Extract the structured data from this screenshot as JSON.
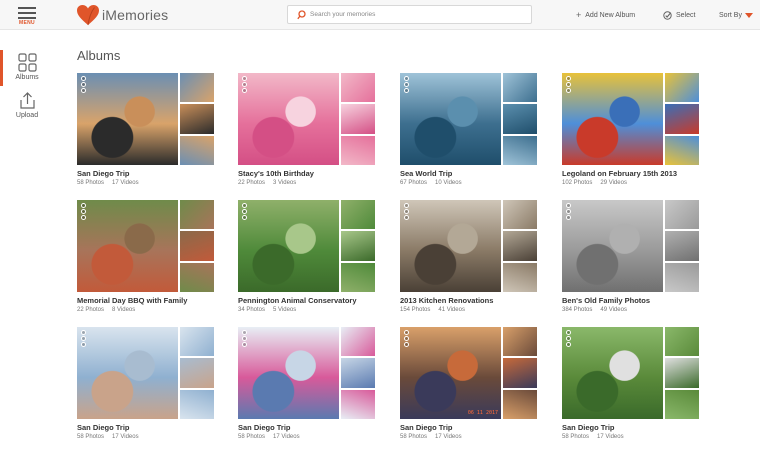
{
  "header": {
    "menu_label": "MENU",
    "logo_text": "iMemories",
    "search_placeholder": "Search your memories",
    "add_album_label": "Add New Album",
    "select_label": "Select",
    "sort_label": "Sort By"
  },
  "sidebar": {
    "items": [
      {
        "label": "Albums",
        "icon": "grid-icon",
        "active": true
      },
      {
        "label": "Upload",
        "icon": "upload-icon",
        "active": false
      }
    ]
  },
  "main": {
    "title": "Albums",
    "albums": [
      {
        "name": "San Diego Trip",
        "photos": "58 Photos",
        "videos": "17 Videos",
        "colors": [
          "#d9a36a",
          "#6b8fb3",
          "#2b2b2b",
          "#c98f5a"
        ]
      },
      {
        "name": "Stacy's 10th Birthday",
        "photos": "22 Photos",
        "videos": "3 Videos",
        "colors": [
          "#e5709b",
          "#f2b8c8",
          "#d44f85",
          "#f7d3df"
        ]
      },
      {
        "name": "Sea World Trip",
        "photos": "67 Photos",
        "videos": "10 Videos",
        "colors": [
          "#3d6f8f",
          "#9fc3d8",
          "#1f4e6b",
          "#5b8fae"
        ]
      },
      {
        "name": "Legoland on February 15th 2013",
        "photos": "102 Photos",
        "videos": "29 Videos",
        "colors": [
          "#4e8fd9",
          "#e8c23a",
          "#c93a2a",
          "#3a6fb8"
        ]
      },
      {
        "name": "Memorial Day BBQ with Family",
        "photos": "22 Photos",
        "videos": "8 Videos",
        "colors": [
          "#a8745a",
          "#6f8b4a",
          "#c25a3a",
          "#8a6a4a"
        ]
      },
      {
        "name": "Pennington Animal Conservatory",
        "photos": "34 Photos",
        "videos": "5 Videos",
        "colors": [
          "#4f8a3a",
          "#8fb06a",
          "#3b6a2a",
          "#a8c78a"
        ]
      },
      {
        "name": "2013 Kitchen Renovations",
        "photos": "154 Photos",
        "videos": "41 Videos",
        "colors": [
          "#8a7a66",
          "#cfc6b8",
          "#4a4036",
          "#b3a896"
        ]
      },
      {
        "name": "Ben's Old Family Photos",
        "photos": "384 Photos",
        "videos": "49 Videos",
        "colors": [
          "#9a9a9a",
          "#c8c8c8",
          "#707070",
          "#b0b0b0"
        ]
      },
      {
        "name": "San Diego Trip",
        "photos": "58 Photos",
        "videos": "17 Videos",
        "colors": [
          "#8fb0d0",
          "#d9e4ee",
          "#c9a38a",
          "#a8bcd0"
        ]
      },
      {
        "name": "San Diego Trip",
        "photos": "58 Photos",
        "videos": "17 Videos",
        "colors": [
          "#d85a9a",
          "#e8eef5",
          "#5a7ab0",
          "#c7d6e6"
        ]
      },
      {
        "name": "San Diego Trip",
        "photos": "58 Photos",
        "videos": "17 Videos",
        "colors": [
          "#6a4a3a",
          "#d9a06a",
          "#3a3a5a",
          "#c76a3a"
        ],
        "stamp": "06 11 2017"
      },
      {
        "name": "San Diego Trip",
        "photos": "58 Photos",
        "videos": "17 Videos",
        "colors": [
          "#5a8a3a",
          "#8ab86a",
          "#3a6a2a",
          "#e0e0e0"
        ]
      }
    ]
  },
  "colors": {
    "accent": "#e0552a",
    "logo_heart": "#e0552a",
    "text": "#333333",
    "muted": "#777777"
  }
}
